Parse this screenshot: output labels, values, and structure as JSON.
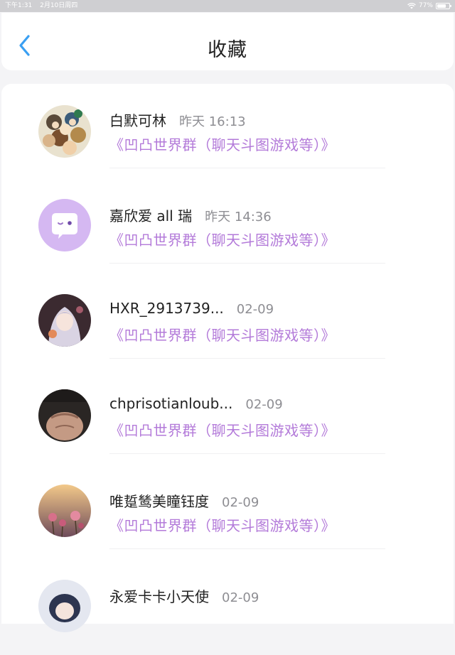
{
  "status_bar": {
    "time": "下午1:31",
    "date": "2月10日周四",
    "battery": "77%",
    "battery_level": 0.77
  },
  "header": {
    "title": "收藏"
  },
  "colors": {
    "accent_blue": "#3a9ff2",
    "group_purple": "#b37ad9",
    "time_gray": "#8e8e93"
  },
  "items": [
    {
      "name": "白默可林",
      "time": "昨天 16:13",
      "group": "《凹凸世界群（聊天斗图游戏等）》",
      "avatar": "anime-group-avatar"
    },
    {
      "name": "嘉欣爱 all 瑞",
      "time": "昨天 14:36",
      "group": "《凹凸世界群（聊天斗图游戏等）》",
      "avatar": "default-chat-avatar"
    },
    {
      "name": "HXR_2913739...",
      "time": "02-09",
      "group": "《凹凸世界群（聊天斗图游戏等）》",
      "avatar": "anime-girl-avatar"
    },
    {
      "name": "chprisotianloub...",
      "time": "02-09",
      "group": "《凹凸世界群（聊天斗图游戏等）》",
      "avatar": "photo-avatar"
    },
    {
      "name": "唯踅鸶美瞳钰度",
      "time": "02-09",
      "group": "《凹凸世界群（聊天斗图游戏等）》",
      "avatar": "flower-avatar"
    },
    {
      "name": "永爱卡卡小天使",
      "time": "02-09",
      "group": "",
      "avatar": "anime-avatar"
    }
  ]
}
